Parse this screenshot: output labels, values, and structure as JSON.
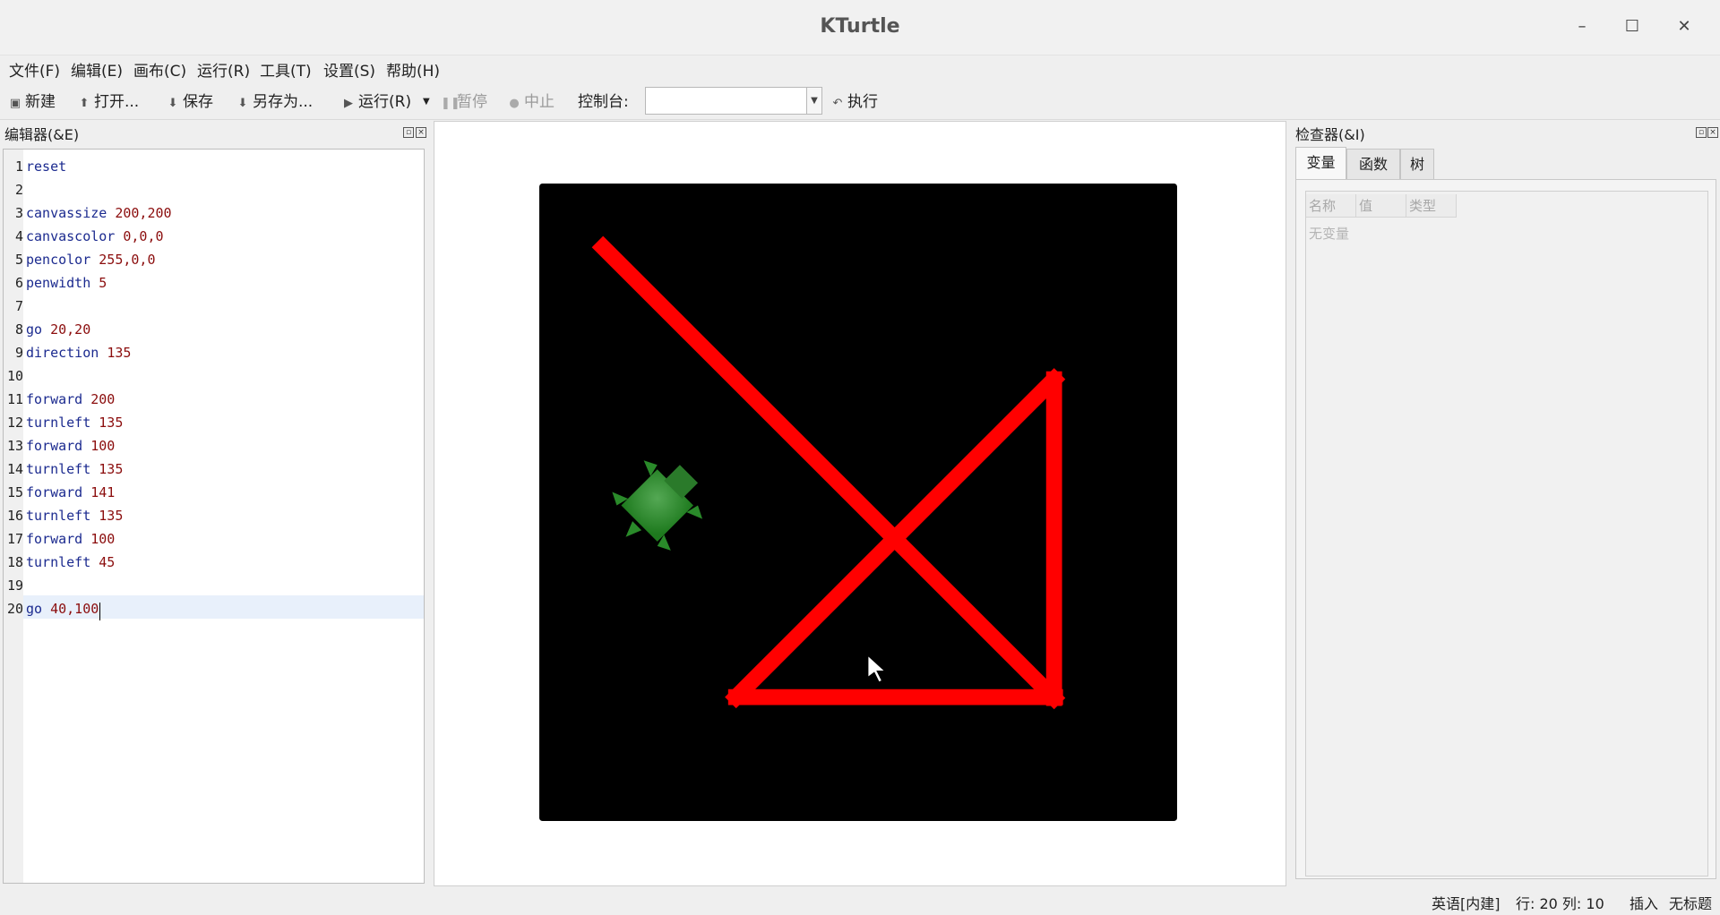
{
  "window": {
    "title": "KTurtle",
    "minimize": "–",
    "maximize": "☐",
    "close": "✕"
  },
  "menu": [
    "文件(F)",
    "编辑(E)",
    "画布(C)",
    "运行(R)",
    "工具(T)",
    "设置(S)",
    "帮助(H)"
  ],
  "toolbar": {
    "new": "新建",
    "open": "打开...",
    "save": "保存",
    "save_as": "另存为...",
    "run": "运行(R)",
    "pause": "暂停",
    "abort": "中止",
    "console_label": "控制台:",
    "console_value": "",
    "execute": "执行"
  },
  "editor": {
    "title": "编辑器(&E)",
    "lines": [
      {
        "n": "1",
        "kw": "reset",
        "args": ""
      },
      {
        "n": "2",
        "kw": "",
        "args": ""
      },
      {
        "n": "3",
        "kw": "canvassize",
        "args": "200,200"
      },
      {
        "n": "4",
        "kw": "canvascolor",
        "args": "0,0,0"
      },
      {
        "n": "5",
        "kw": "pencolor",
        "args": "255,0,0"
      },
      {
        "n": "6",
        "kw": "penwidth",
        "args": "5"
      },
      {
        "n": "7",
        "kw": "",
        "args": ""
      },
      {
        "n": "8",
        "kw": "go",
        "args": "20,20"
      },
      {
        "n": "9",
        "kw": "direction",
        "args": "135"
      },
      {
        "n": "10",
        "kw": "",
        "args": ""
      },
      {
        "n": "11",
        "kw": "forward",
        "args": "200"
      },
      {
        "n": "12",
        "kw": "turnleft",
        "args": "135"
      },
      {
        "n": "13",
        "kw": "forward",
        "args": "100"
      },
      {
        "n": "14",
        "kw": "turnleft",
        "args": "135"
      },
      {
        "n": "15",
        "kw": "forward",
        "args": "141"
      },
      {
        "n": "16",
        "kw": "turnleft",
        "args": "135"
      },
      {
        "n": "17",
        "kw": "forward",
        "args": "100"
      },
      {
        "n": "18",
        "kw": "turnleft",
        "args": "45"
      },
      {
        "n": "19",
        "kw": "",
        "args": ""
      },
      {
        "n": "20",
        "kw": "go",
        "args": "40,100"
      }
    ]
  },
  "canvas": {
    "background": "#000000",
    "pen_color": "#ff0000",
    "turtle_color": "#2e8b2e"
  },
  "inspector": {
    "title": "检查器(&I)",
    "tabs": [
      "变量",
      "函数",
      "树"
    ],
    "columns": [
      "名称",
      "值",
      "类型"
    ],
    "empty": "无变量"
  },
  "status": {
    "language": "英语[内建]",
    "position": "行: 20 列: 10",
    "mode": "插入",
    "doc": "无标题"
  }
}
